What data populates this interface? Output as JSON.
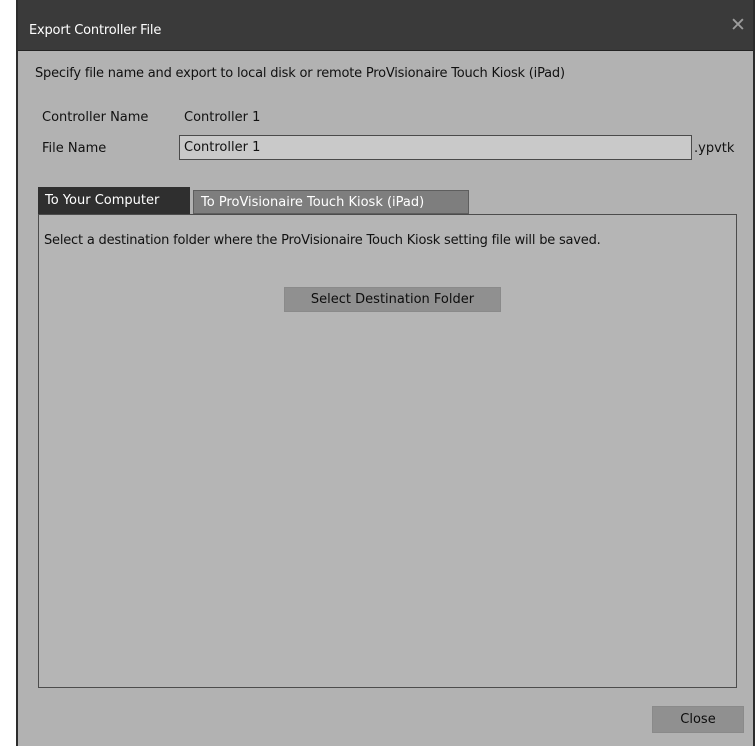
{
  "window": {
    "title": "Export Controller File",
    "close_glyph": "✕"
  },
  "instruction": "Specify file name and export to local disk or remote ProVisionaire Touch Kiosk (iPad)",
  "controller_name": {
    "label": "Controller Name",
    "value": "Controller 1"
  },
  "file_name": {
    "label": "File Name",
    "value": "Controller 1",
    "extension": ".ypvtk"
  },
  "tabs": [
    {
      "label": "To Your Computer",
      "active": true
    },
    {
      "label": "To ProVisionaire Touch Kiosk (iPad)",
      "active": false
    }
  ],
  "panel": {
    "description": "Select a destination folder where the ProVisionaire Touch Kiosk setting file will be saved.",
    "select_folder_label": "Select Destination Folder"
  },
  "footer": {
    "close_label": "Close"
  },
  "colors": {
    "titlebar": "#3a3a3a",
    "dialog_bg": "#b2b2b2",
    "active_tab": "#2f2f2f",
    "inactive_tab": "#7e7e7e",
    "button": "#909090"
  }
}
